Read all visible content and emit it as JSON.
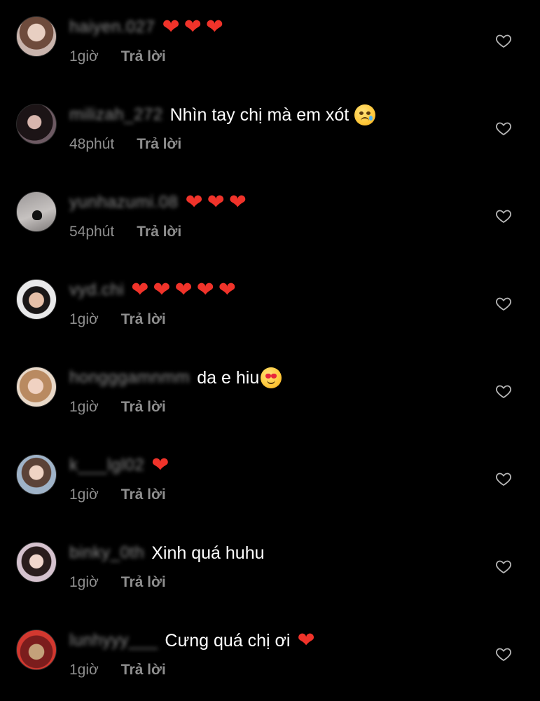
{
  "colors": {
    "background": "#000000",
    "text_primary": "#ffffff",
    "text_secondary": "#8e8e8e",
    "heart_emoji": "#f0332a"
  },
  "comments": [
    {
      "username": "haiyen.027",
      "text": "",
      "emojis": [
        "red-heart",
        "red-heart",
        "red-heart"
      ],
      "time": "1giờ",
      "reply_label": "Trả lời"
    },
    {
      "username": "milizah_272",
      "text": "Nhìn tay chị mà em xót",
      "emojis": [
        "crying-face"
      ],
      "time": "48phút",
      "reply_label": "Trả lời"
    },
    {
      "username": "yunhazumi.08",
      "text": "",
      "emojis": [
        "red-heart",
        "red-heart",
        "red-heart"
      ],
      "time": "54phút",
      "reply_label": "Trả lời"
    },
    {
      "username": "vyd.chi",
      "text": "",
      "emojis": [
        "red-heart",
        "red-heart",
        "red-heart",
        "red-heart",
        "red-heart"
      ],
      "time": "1giờ",
      "reply_label": "Trả lời"
    },
    {
      "username": "hongggamnmm",
      "text": "da e hiu",
      "emojis": [
        "heart-eyes-face"
      ],
      "time": "1giờ",
      "reply_label": "Trả lời"
    },
    {
      "username": "k___lgl02",
      "text": "",
      "emojis": [
        "red-heart"
      ],
      "time": "1giờ",
      "reply_label": "Trả lời"
    },
    {
      "username": "binky_0th",
      "text": "Xinh quá huhu",
      "emojis": [],
      "time": "1giờ",
      "reply_label": "Trả lời"
    },
    {
      "username": "lunhyyy___",
      "text": "Cưng quá chị ơi",
      "emojis": [
        "red-heart"
      ],
      "time": "1giờ",
      "reply_label": "Trả lời"
    }
  ]
}
